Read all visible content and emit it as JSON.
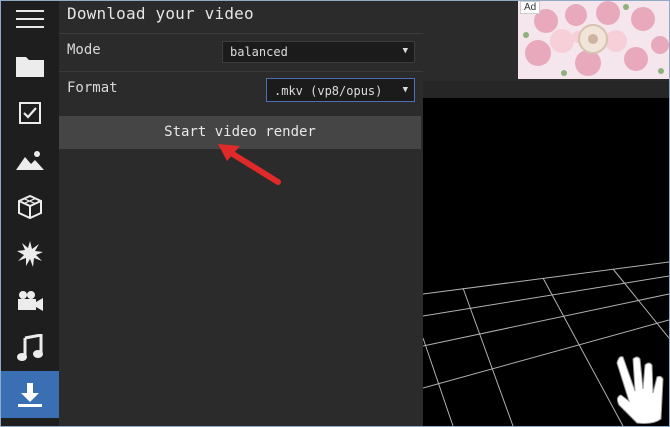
{
  "sidebar": {
    "items": [
      {
        "icon": "hamburger-menu-icon"
      },
      {
        "icon": "folder-icon"
      },
      {
        "icon": "checkbox-icon"
      },
      {
        "icon": "image-mountain-icon"
      },
      {
        "icon": "cube-icon"
      },
      {
        "icon": "burst-effects-icon"
      },
      {
        "icon": "video-camera-icon"
      },
      {
        "icon": "music-note-icon"
      },
      {
        "icon": "download-icon",
        "active": true
      }
    ]
  },
  "panel": {
    "title": "Download your video",
    "mode": {
      "label": "Mode",
      "value": "balanced"
    },
    "format": {
      "label": "Format",
      "value": ".mkv (vp8/opus)"
    },
    "render_button": "Start video render"
  },
  "ad": {
    "label": "Ad"
  },
  "colors": {
    "accent": "#3a6fb3",
    "arrow": "#e02a2a"
  }
}
